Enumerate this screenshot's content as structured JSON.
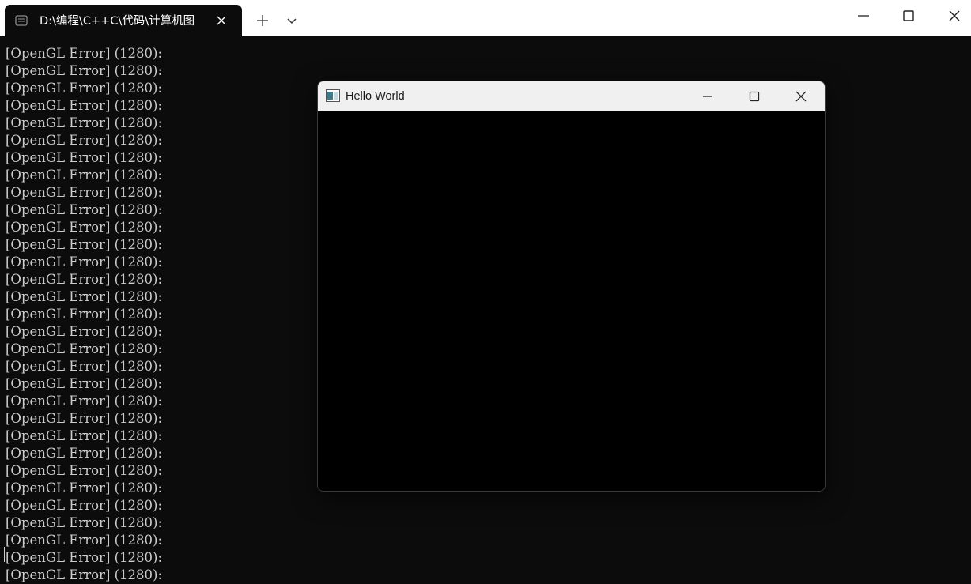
{
  "terminal": {
    "tab_title": "D:\\编程\\C++C\\代码\\计算机图",
    "tab_icon": "terminal-icon",
    "lines": [
      "[OpenGL Error] (1280):",
      "[OpenGL Error] (1280):",
      "[OpenGL Error] (1280):",
      "[OpenGL Error] (1280):",
      "[OpenGL Error] (1280):",
      "[OpenGL Error] (1280):",
      "[OpenGL Error] (1280):",
      "[OpenGL Error] (1280):",
      "[OpenGL Error] (1280):",
      "[OpenGL Error] (1280):",
      "[OpenGL Error] (1280):",
      "[OpenGL Error] (1280):",
      "[OpenGL Error] (1280):",
      "[OpenGL Error] (1280):",
      "[OpenGL Error] (1280):",
      "[OpenGL Error] (1280):",
      "[OpenGL Error] (1280):",
      "[OpenGL Error] (1280):",
      "[OpenGL Error] (1280):",
      "[OpenGL Error] (1280):",
      "[OpenGL Error] (1280):",
      "[OpenGL Error] (1280):",
      "[OpenGL Error] (1280):",
      "[OpenGL Error] (1280):",
      "[OpenGL Error] (1280):",
      "[OpenGL Error] (1280):",
      "[OpenGL Error] (1280):",
      "[OpenGL Error] (1280):",
      "[OpenGL Error] (1280):",
      "[OpenGL Error] (1280):",
      "[OpenGL Error] (1280):"
    ]
  },
  "gl_window": {
    "title": "Hello World",
    "icon": "app-window-icon"
  },
  "colors": {
    "terminal_bg": "#0c0c0c",
    "terminal_text": "#cccccc",
    "titlebar_bg": "#ffffff",
    "gl_canvas": "#000000"
  }
}
